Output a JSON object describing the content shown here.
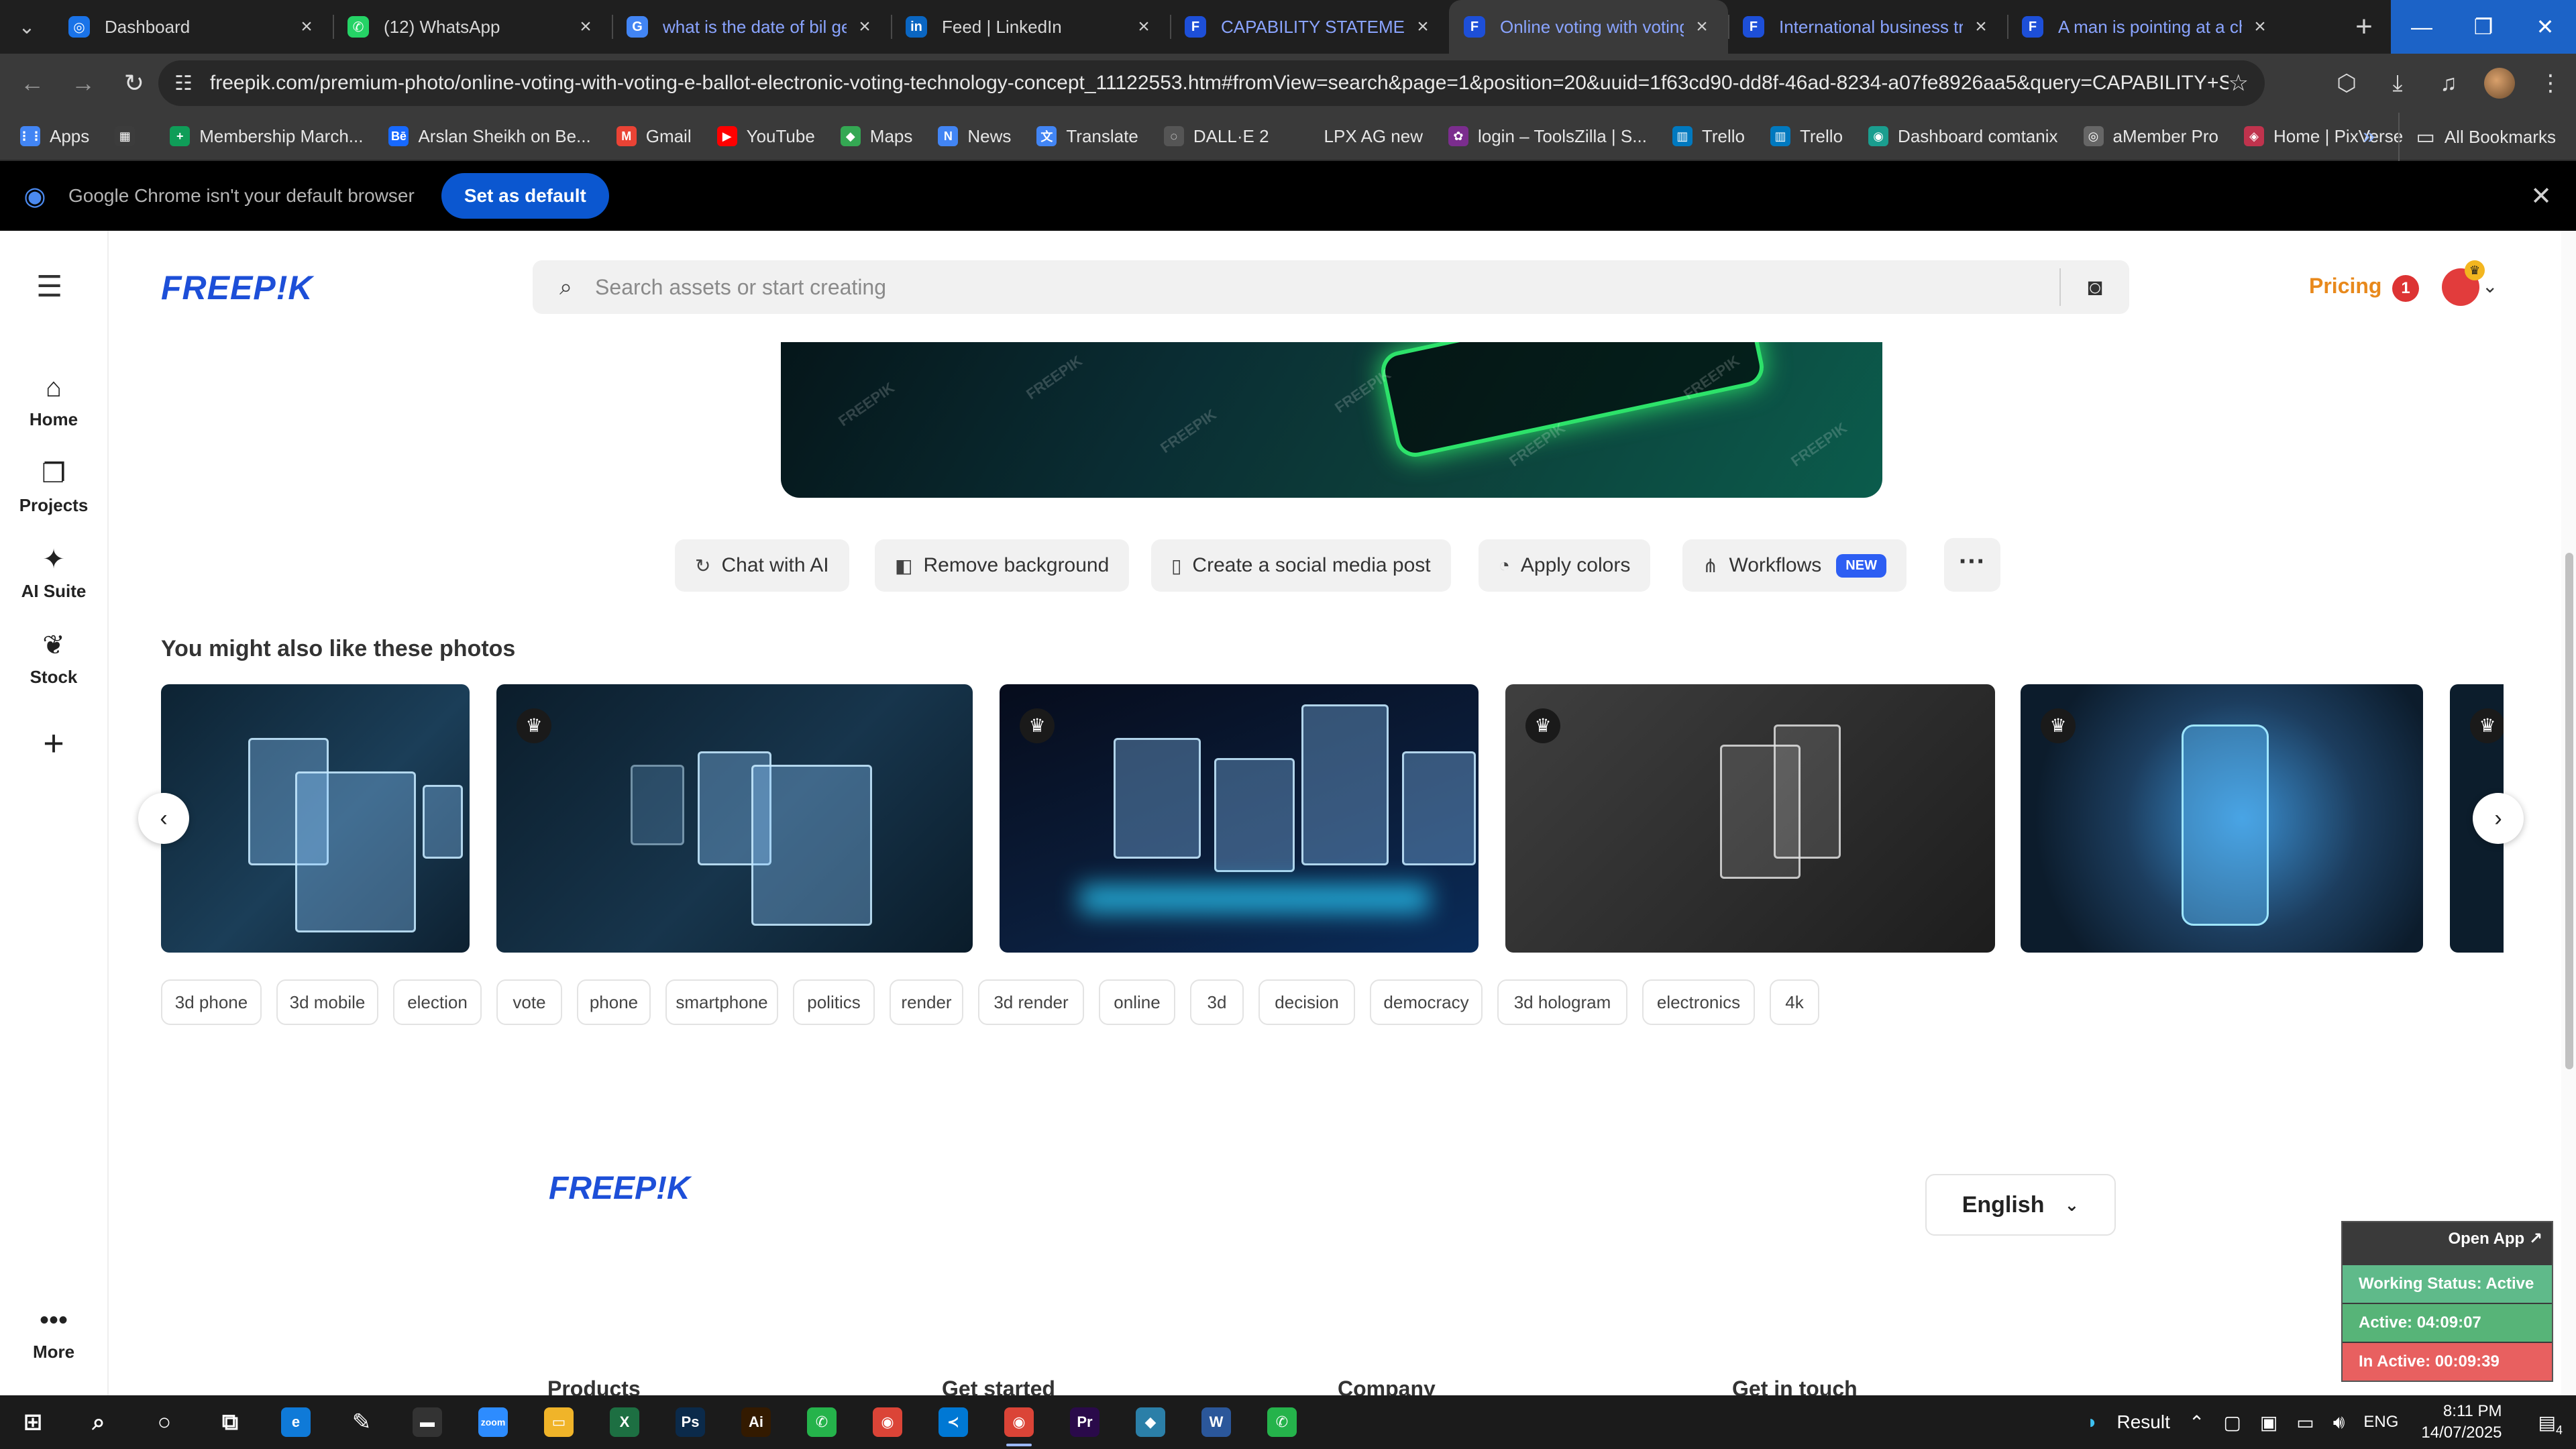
{
  "browser": {
    "tabs": [
      {
        "title": "Dashboard",
        "fav_color": "#1a73e8",
        "fav_glyph": "◎"
      },
      {
        "title": "(12) WhatsApp",
        "fav_color": "#25d366",
        "fav_glyph": "✆"
      },
      {
        "title": "what is the date of bil ge",
        "fav_color": "#4285f4",
        "fav_glyph": "G"
      },
      {
        "title": "Feed | LinkedIn",
        "fav_color": "#0a66c2",
        "fav_glyph": "in"
      },
      {
        "title": "CAPABILITY STATEMENT F",
        "fav_color": "#1d4fd8",
        "fav_glyph": "F"
      },
      {
        "title": "Online voting with voting",
        "fav_color": "#1d4fd8",
        "fav_glyph": "F"
      },
      {
        "title": "International business tra",
        "fav_color": "#1d4fd8",
        "fav_glyph": "F"
      },
      {
        "title": "A man is pointing at a ch",
        "fav_color": "#1d4fd8",
        "fav_glyph": "F"
      }
    ],
    "active_tab_index": 5,
    "url": "freepik.com/premium-photo/online-voting-with-voting-e-ballot-electronic-voting-technology-concept_11122553.htm#fromView=search&page=1&position=20&uuid=1f63cd90-dd8f-46ad-8234-a07fe8926aa5&query=CAPABILITY+STATEMENT",
    "bookmarks": [
      {
        "label": "Apps",
        "icon_color": "#4285f4",
        "glyph": "⋮⋮"
      },
      {
        "label": "",
        "icon_color": "#3c3c3c",
        "glyph": "▦"
      },
      {
        "label": "Membership March...",
        "icon_color": "#0f9d58",
        "glyph": "+"
      },
      {
        "label": "Arslan Sheikh on Be...",
        "icon_color": "#1769ff",
        "glyph": "Bē"
      },
      {
        "label": "Gmail",
        "icon_color": "#ea4335",
        "glyph": "M"
      },
      {
        "label": "YouTube",
        "icon_color": "#ff0000",
        "glyph": "▶"
      },
      {
        "label": "Maps",
        "icon_color": "#34a853",
        "glyph": "◆"
      },
      {
        "label": "News",
        "icon_color": "#4285f4",
        "glyph": "N"
      },
      {
        "label": "Translate",
        "icon_color": "#4285f4",
        "glyph": "文"
      },
      {
        "label": "DALL·E 2",
        "icon_color": "#555555",
        "glyph": "◌"
      },
      {
        "label": "LPX AG new",
        "icon_color": "#3a3a3a",
        "glyph": ""
      },
      {
        "label": "login – ToolsZilla | S...",
        "icon_color": "#7b2d8e",
        "glyph": "✿"
      },
      {
        "label": "Trello",
        "icon_color": "#0079bf",
        "glyph": "▥"
      },
      {
        "label": "Trello",
        "icon_color": "#0079bf",
        "glyph": "▥"
      },
      {
        "label": "Dashboard comtanix",
        "icon_color": "#1a9e8f",
        "glyph": "◉"
      },
      {
        "label": "aMember Pro",
        "icon_color": "#666666",
        "glyph": "◎"
      },
      {
        "label": "Home | PixVerse",
        "icon_color": "#c0334d",
        "glyph": "◈"
      }
    ],
    "all_bookmarks_label": "All Bookmarks",
    "infobar_message": "Google Chrome isn't your default browser",
    "infobar_button": "Set as default"
  },
  "freepik": {
    "logo_text": "FREEP!K",
    "rail": [
      {
        "label": "Home",
        "icon": "home-icon",
        "glyph": "⌂"
      },
      {
        "label": "Projects",
        "icon": "projects-icon",
        "glyph": "❐"
      },
      {
        "label": "AI Suite",
        "icon": "sparkle-icon",
        "glyph": "✦"
      },
      {
        "label": "Stock",
        "icon": "stock-icon",
        "glyph": "❦"
      }
    ],
    "rail_more_label": "More",
    "search_placeholder": "Search assets or start creating",
    "pricing_label": "Pricing",
    "notification_count": "1",
    "actions": [
      {
        "label": "Chat with AI",
        "icon": "chat-ai-icon",
        "glyph": "↻"
      },
      {
        "label": "Remove background",
        "icon": "remove-bg-icon",
        "glyph": "◧"
      },
      {
        "label": "Create a social media post",
        "icon": "phone-icon",
        "glyph": "▯"
      },
      {
        "label": "Apply colors",
        "icon": "palette-icon",
        "glyph": "◔"
      },
      {
        "label": "Workflows",
        "icon": "workflow-icon",
        "glyph": "⋔",
        "badge": "NEW"
      }
    ],
    "watermark": "FREEPIK",
    "related_title": "You might also like these photos",
    "tags": [
      "3d phone",
      "3d mobile",
      "election",
      "vote",
      "phone",
      "smartphone",
      "politics",
      "render",
      "3d render",
      "online",
      "3d",
      "decision",
      "democracy",
      "3d hologram",
      "electronics",
      "4k"
    ],
    "footer": {
      "logo_text": "FREEP!K",
      "language": "English",
      "columns": [
        "Products",
        "Get started",
        "Company",
        "Get in touch"
      ]
    }
  },
  "status_widget": {
    "open_app": "Open App ↗",
    "working_status": "Working Status: Active",
    "active": "Active: 04:09:07",
    "inactive": "In Active: 00:09:39",
    "colors": {
      "working": "#5fba8a",
      "active": "#57b478",
      "inactive": "#e86060"
    }
  },
  "taskbar": {
    "apps": [
      {
        "name": "start-icon",
        "glyph": "⊞",
        "color": "transparent"
      },
      {
        "name": "search-icon",
        "glyph": "⌕",
        "color": "transparent"
      },
      {
        "name": "cortana-icon",
        "glyph": "○",
        "color": "transparent"
      },
      {
        "name": "task-view-icon",
        "glyph": "⧉",
        "color": "transparent"
      },
      {
        "name": "edge-icon",
        "glyph": "e",
        "color": "#0f7ad8"
      },
      {
        "name": "pen-icon",
        "glyph": "✎",
        "color": "transparent"
      },
      {
        "name": "terminal-icon",
        "glyph": "▬",
        "color": "#333333"
      },
      {
        "name": "zoom-icon",
        "glyph": "zoom",
        "color": "#2d8cff"
      },
      {
        "name": "file-explorer-icon",
        "glyph": "▭",
        "color": "#f0b429"
      },
      {
        "name": "excel-icon",
        "glyph": "X",
        "color": "#1d6f42"
      },
      {
        "name": "photoshop-icon",
        "glyph": "Ps",
        "color": "#0b2a4a"
      },
      {
        "name": "illustrator-icon",
        "glyph": "Ai",
        "color": "#331a00"
      },
      {
        "name": "chat-app-icon",
        "glyph": "✆",
        "color": "#25b34b"
      },
      {
        "name": "chrome-icon",
        "glyph": "◉",
        "color": "#db4437"
      },
      {
        "name": "vscode-icon",
        "glyph": "≺",
        "color": "#0078d4"
      },
      {
        "name": "chrome-active-icon",
        "glyph": "◉",
        "color": "#db4437"
      },
      {
        "name": "premiere-icon",
        "glyph": "Pr",
        "color": "#2a0a4a"
      },
      {
        "name": "app-icon",
        "glyph": "◆",
        "color": "#2b7fa8"
      },
      {
        "name": "word-icon",
        "glyph": "W",
        "color": "#2b579a"
      },
      {
        "name": "chat-app-2-icon",
        "glyph": "✆",
        "color": "#25b34b"
      }
    ],
    "tray_label": "Result",
    "language": "ENG",
    "time": "8:11 PM",
    "date": "14/07/2025",
    "notifications": "4"
  }
}
